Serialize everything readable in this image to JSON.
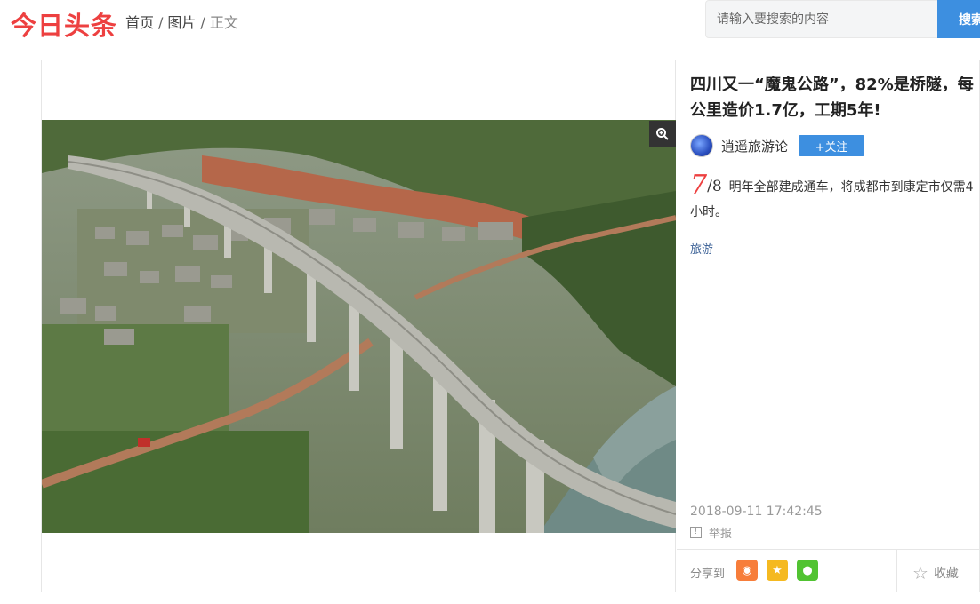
{
  "header": {
    "logo": "今日头条",
    "breadcrumb": [
      "首页",
      "图片",
      "正文"
    ],
    "search_placeholder": "请输入要搜索的内容",
    "search_button": "搜索"
  },
  "article": {
    "title": "四川又一“魔鬼公路”，82%是桥隧，每公里造价1.7亿，工期5年!",
    "author": "逍遥旅游论",
    "follow_label": "+关注",
    "image_index": "7",
    "image_total": "/8",
    "caption": "明年全部建成通车，将成都市到康定市仅需4小时。",
    "tag": "旅游",
    "timestamp": "2018-09-11 17:42:45",
    "report_label": "举报",
    "share_label": "分享到",
    "favorite_label": "收藏"
  },
  "colors": {
    "brand_red": "#ed4040",
    "accent_blue": "#3d8fe0",
    "weibo": "#f77d3a",
    "qzone": "#f5b920",
    "wechat": "#51c332"
  }
}
